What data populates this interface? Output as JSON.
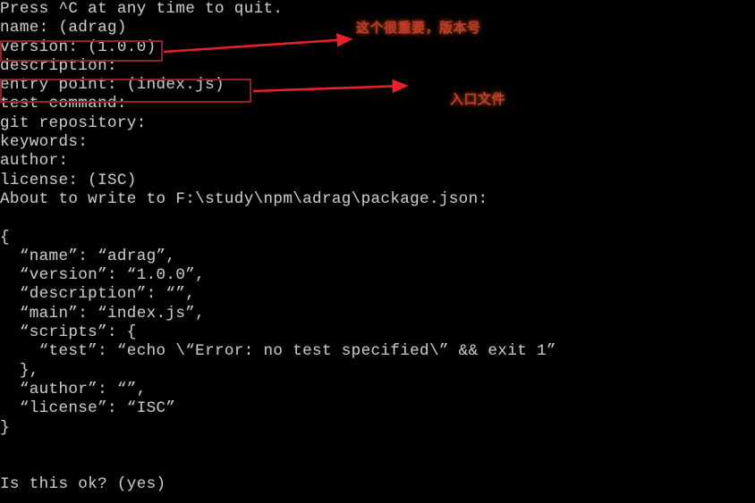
{
  "terminal": {
    "title": "npm init interactive prompt",
    "background_color": "#000000",
    "text_color": "#c5c5c5",
    "lines": [
      "Press ^C at any time to quit.",
      "name: (adrag)",
      "version: (1.0.0)",
      "description:",
      "entry point: (index.js)",
      "test command:",
      "git repository:",
      "keywords:",
      "author:",
      "license: (ISC)",
      "About to write to F:\\study\\npm\\adrag\\package.json:",
      "",
      "{",
      "  “name”: “adrag”,",
      "  “version”: “1.0.0”,",
      "  “description”: “”,",
      "  “main”: “index.js”,",
      "  “scripts”: {",
      "    “test”: “echo \\“Error: no test specified\\” && exit 1”",
      "  },",
      "  “author”: “”,",
      "  “license”: “ISC”",
      "}",
      "",
      "",
      "Is this ok? (yes)"
    ]
  },
  "annotations": {
    "color_box": "#8e2230",
    "color_arrow": "#e8202a",
    "color_text": "#c0392b",
    "items": [
      {
        "id": "version",
        "highlighted_text": "version: (1.0.0)",
        "note": "这个很重要，版本号"
      },
      {
        "id": "entry-point",
        "highlighted_text": "entry point: (index.js)",
        "note": "入口文件"
      }
    ]
  }
}
